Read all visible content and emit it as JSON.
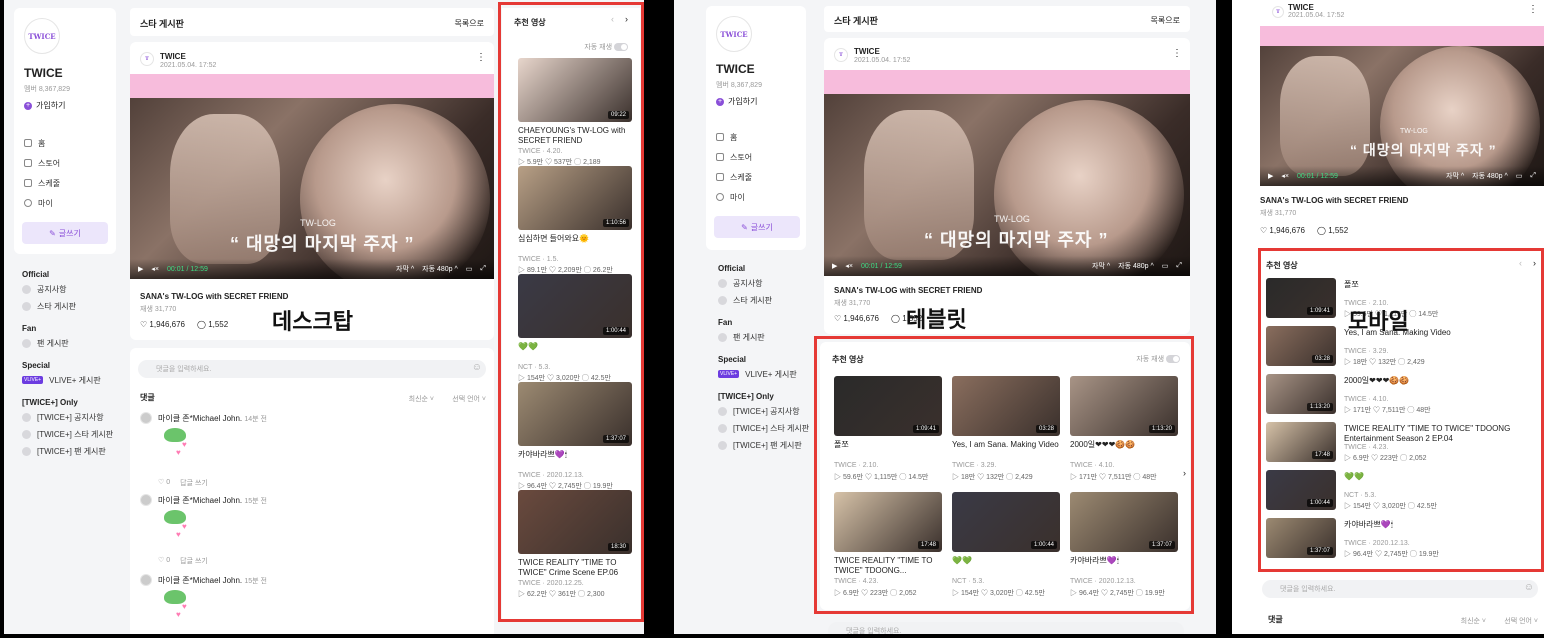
{
  "labels": {
    "desktop": "데스크탑",
    "tablet": "테블릿",
    "mobile": "모바일"
  },
  "community": {
    "name": "TWICE",
    "logo_text": "TWICE",
    "members": "멤버 8,367,829",
    "join": "가입하기",
    "write": "글쓰기"
  },
  "menu": [
    {
      "icon": "grid-icon",
      "label": "홈"
    },
    {
      "icon": "store-icon",
      "label": "스토어"
    },
    {
      "icon": "schedule-icon",
      "label": "스케줄"
    },
    {
      "icon": "user-icon",
      "label": "마이"
    }
  ],
  "sections": {
    "official": {
      "title": "Official",
      "items": [
        "공지사항",
        "스타 게시판"
      ]
    },
    "fan": {
      "title": "Fan",
      "items": [
        "팬 게시판"
      ]
    },
    "special": {
      "title": "Special",
      "badge": "VLIVE+",
      "items": [
        "VLIVE+ 게시판"
      ]
    },
    "only": {
      "title": "[TWICE+] Only",
      "items": [
        "[TWICE+] 공지사항",
        "[TWICE+] 스타 게시판",
        "[TWICE+] 팬 게시판"
      ]
    }
  },
  "board": {
    "title": "스타 게시판",
    "back": "목록으로"
  },
  "post": {
    "author": "TWICE",
    "date": "2021.05.04. 17:52",
    "title": "SANA's TW-LOG with SECRET FRIEND",
    "views": "재생 31,770",
    "likes": "1,946,676",
    "comments": "1,552",
    "caption_small": "TW-LOG",
    "caption_big": "“ 대망의 마지막 주자 ”",
    "time": "00:01 / 12:59",
    "subtitle": "자막 ^",
    "quality": "자동 480p ^"
  },
  "comments_ui": {
    "placeholder": "댓글을 입력하세요.",
    "title": "댓글",
    "sort": "최신순 ˅",
    "lang": "선택 언어 ˅",
    "items": [
      {
        "author": "마이클 존*Michael John.",
        "time": "14분 전",
        "likes": "0",
        "reply": "답글 쓰기"
      },
      {
        "author": "마이클 존*Michael John.",
        "time": "15분 전",
        "likes": "0",
        "reply": "답글 쓰기"
      },
      {
        "author": "마이클 존*Michael John.",
        "time": "15분 전",
        "likes": "0",
        "reply": "답글 쓰기"
      }
    ]
  },
  "recommend": {
    "title": "추천 영상",
    "autoplay": "자동 재생",
    "videos": [
      {
        "title": "CHAEYOUNG's TW-LOG with SECRET FRIEND",
        "meta": "TWICE · 4.20.",
        "plays": "5.9만",
        "likes": "537만",
        "comments": "2,189",
        "dur": "09:22",
        "tone": "#e8d6cc"
      },
      {
        "title": "심심하면 들어와요🌞",
        "meta": "TWICE · 1.5.",
        "plays": "89.1만",
        "likes": "2,209만",
        "comments": "26.2만",
        "dur": "1:10:56",
        "tone": "#b8a086"
      },
      {
        "title": "💚💚",
        "meta": "NCT · 5.3.",
        "plays": "154만",
        "likes": "3,020만",
        "comments": "42.5만",
        "dur": "1:00:44",
        "tone": "#3a3a46"
      },
      {
        "title": "카야바라쁘💜🕯",
        "meta": "TWICE · 2020.12.13.",
        "plays": "96.4만",
        "likes": "2,745만",
        "comments": "19.9만",
        "dur": "1:37:07",
        "tone": "#9c8a72"
      },
      {
        "title": "TWICE REALITY \"TIME TO TWICE\" Crime Scene EP.06",
        "meta": "TWICE · 2020.12.25.",
        "plays": "62.2만",
        "likes": "361만",
        "comments": "2,300",
        "dur": "18:30",
        "tone": "#6a4a3e"
      }
    ],
    "tablet": [
      {
        "title": "폴쪼",
        "meta": "TWICE · 2.10.",
        "plays": "59.6만",
        "likes": "1,115만",
        "comments": "14.5만",
        "dur": "1:09:41",
        "tone": "#2a2a2a"
      },
      {
        "title": "Yes, I am Sana. Making Video",
        "meta": "TWICE · 3.29.",
        "plays": "18만",
        "likes": "132만",
        "comments": "2,429",
        "dur": "03:28",
        "tone": "#8a6e5e"
      },
      {
        "title": "2000일❤❤❤🍪🍪",
        "meta": "TWICE · 4.10.",
        "plays": "171만",
        "likes": "7,511만",
        "comments": "48만",
        "dur": "1:13:20",
        "tone": "#a89486"
      },
      {
        "title": "TWICE REALITY \"TIME TO TWICE\" TDOONG...",
        "meta": "TWICE · 4.23.",
        "plays": "6.9만",
        "likes": "223만",
        "comments": "2,052",
        "dur": "17:48",
        "tone": "#d6c2a8"
      },
      {
        "title": "💚💚",
        "meta": "NCT · 5.3.",
        "plays": "154만",
        "likes": "3,020만",
        "comments": "42.5만",
        "dur": "1:00:44",
        "tone": "#3a3a46"
      },
      {
        "title": "카야바라쁘💜🕯",
        "meta": "TWICE · 2020.12.13.",
        "plays": "96.4만",
        "likes": "2,745만",
        "comments": "19.9만",
        "dur": "1:37:07",
        "tone": "#9c8a72"
      }
    ],
    "mobile": [
      {
        "title": "폴쪼",
        "meta": "TWICE · 2.10.",
        "plays": "59.6만",
        "likes": "1,115만",
        "comments": "14.5만",
        "dur": "1:09:41",
        "tone": "#2a2a2a"
      },
      {
        "title": "Yes, I am Sana. Making Video",
        "meta": "TWICE · 3.29.",
        "plays": "18만",
        "likes": "132만",
        "comments": "2,429",
        "dur": "03:28",
        "tone": "#8a6e5e"
      },
      {
        "title": "2000일❤❤❤🍪🍪",
        "meta": "TWICE · 4.10.",
        "plays": "171만",
        "likes": "7,511만",
        "comments": "48만",
        "dur": "1:13:20",
        "tone": "#a89486"
      },
      {
        "title": "TWICE REALITY \"TIME TO TWICE\" TDOONG Entertainment Season 2 EP.04",
        "meta": "TWICE · 4.23.",
        "plays": "6.9만",
        "likes": "223만",
        "comments": "2,052",
        "dur": "17:48",
        "tone": "#d6c2a8"
      },
      {
        "title": "💚💚",
        "meta": "NCT · 5.3.",
        "plays": "154만",
        "likes": "3,020만",
        "comments": "42.5만",
        "dur": "1:00:44",
        "tone": "#3a3a46"
      },
      {
        "title": "카야바라쁘💜🕯",
        "meta": "TWICE · 2020.12.13.",
        "plays": "96.4만",
        "likes": "2,745만",
        "comments": "19.9만",
        "dur": "1:37:07",
        "tone": "#9c8a72"
      }
    ]
  },
  "icons": {
    "play": "▶",
    "mute": "🔇",
    "heart": "♡",
    "comment": "💬",
    "more": "⋮",
    "prev": "‹",
    "next": "›",
    "smile": "☺"
  }
}
